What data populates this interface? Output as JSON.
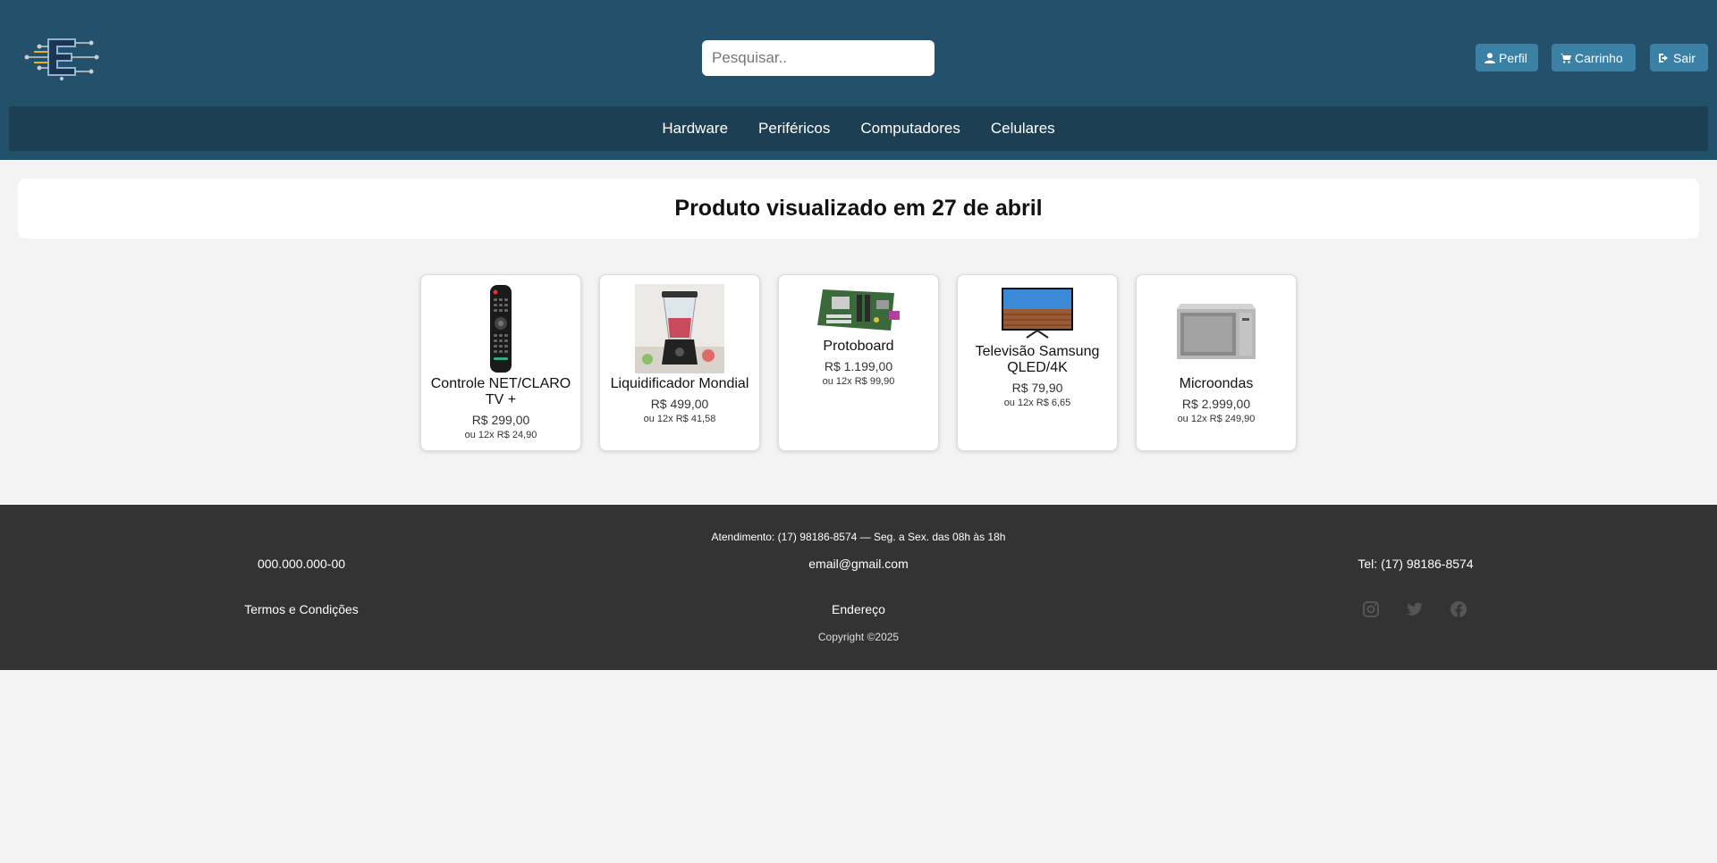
{
  "header": {
    "search_placeholder": "Pesquisar..",
    "buttons": {
      "profile": "Perfil",
      "cart": "Carrinho",
      "exit": "Sair"
    },
    "categories": [
      "Hardware",
      "Periféricos",
      "Computadores",
      "Celulares"
    ]
  },
  "main": {
    "title": "Produto visualizado em 27 de abril",
    "products": [
      {
        "name": "Controle NET/CLARO TV +",
        "price": "R$ 299,00",
        "installment": "ou 12x R$ 24,90",
        "icon": "remote-control-image"
      },
      {
        "name": "Liquidificador Mondial",
        "price": "R$ 499,00",
        "installment": "ou 12x R$ 41,58",
        "icon": "blender-image"
      },
      {
        "name": "Protoboard",
        "price": "R$ 1.199,00",
        "installment": "ou 12x R$ 99,90",
        "icon": "motherboard-image"
      },
      {
        "name": "Televisão Samsung QLED/4K",
        "price": "R$ 79,90",
        "installment": "ou 12x R$ 6,65",
        "icon": "television-image"
      },
      {
        "name": "Microondas",
        "price": "R$ 2.999,00",
        "installment": "ou 12x R$ 249,90",
        "icon": "microwave-image"
      }
    ]
  },
  "footer": {
    "attendance": "Atendimento: (17) 98186-8574 — Seg. a Sex. das 08h às 18h",
    "cnpj": "000.000.000-00",
    "email": "email@gmail.com",
    "phone": "Tel: (17) 98186-8574",
    "terms": "Termos e Condições",
    "address": "Endereço",
    "copyright": "Copyright ©2025",
    "social": [
      "instagram-icon",
      "twitter-icon",
      "facebook-icon"
    ]
  },
  "colors": {
    "header": "#23506a",
    "nav": "#1c3f54",
    "button": "#3b81a6",
    "footer": "#333333"
  }
}
